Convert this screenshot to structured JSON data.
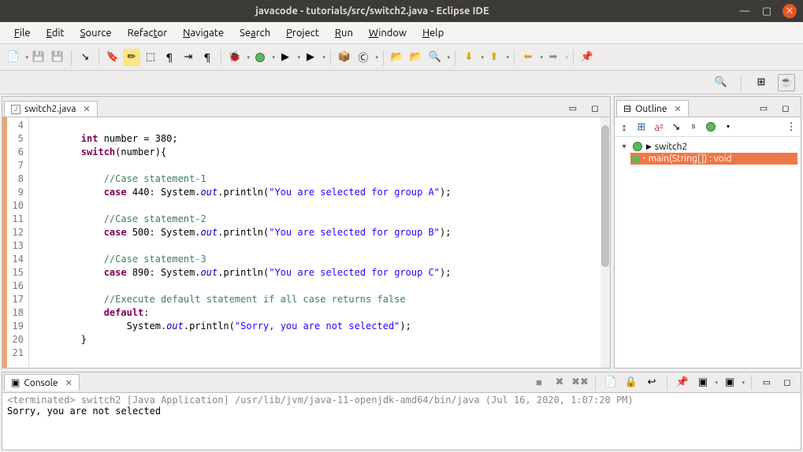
{
  "window": {
    "title": "javacode - tutorials/src/switch2.java - Eclipse IDE"
  },
  "menus": [
    "File",
    "Edit",
    "Source",
    "Refactor",
    "Navigate",
    "Search",
    "Project",
    "Run",
    "Window",
    "Help"
  ],
  "editor": {
    "tab_name": "switch2.java",
    "line_start": 4,
    "code_lines": [
      {
        "n": 4,
        "raw": ""
      },
      {
        "n": 5,
        "raw": "        int number = 380;"
      },
      {
        "n": 6,
        "raw": "        switch(number){"
      },
      {
        "n": 7,
        "raw": ""
      },
      {
        "n": 8,
        "raw": "            //Case statement-1"
      },
      {
        "n": 9,
        "raw": "            case 440: System.out.println(\"You are selected for group A\");"
      },
      {
        "n": 10,
        "raw": ""
      },
      {
        "n": 11,
        "raw": "            //Case statement-2"
      },
      {
        "n": 12,
        "raw": "            case 500: System.out.println(\"You are selected for group B\");"
      },
      {
        "n": 13,
        "raw": ""
      },
      {
        "n": 14,
        "raw": "            //Case statement-3"
      },
      {
        "n": 15,
        "raw": "            case 890: System.out.println(\"You are selected for group C\");"
      },
      {
        "n": 16,
        "raw": ""
      },
      {
        "n": 17,
        "raw": "            //Execute default statement if all case returns false"
      },
      {
        "n": 18,
        "raw": "            default:"
      },
      {
        "n": 19,
        "raw": "                System.out.println(\"Sorry, you are not selected\");"
      },
      {
        "n": 20,
        "raw": "        }"
      },
      {
        "n": 21,
        "raw": ""
      }
    ]
  },
  "outline": {
    "title": "Outline",
    "root": "switch2",
    "child": "main(String[]) : void"
  },
  "console": {
    "title": "Console",
    "header": "<terminated> switch2 [Java Application] /usr/lib/jvm/java-11-openjdk-amd64/bin/java (Jul 16, 2020, 1:07:20 PM)",
    "output": "Sorry, you are not selected"
  }
}
